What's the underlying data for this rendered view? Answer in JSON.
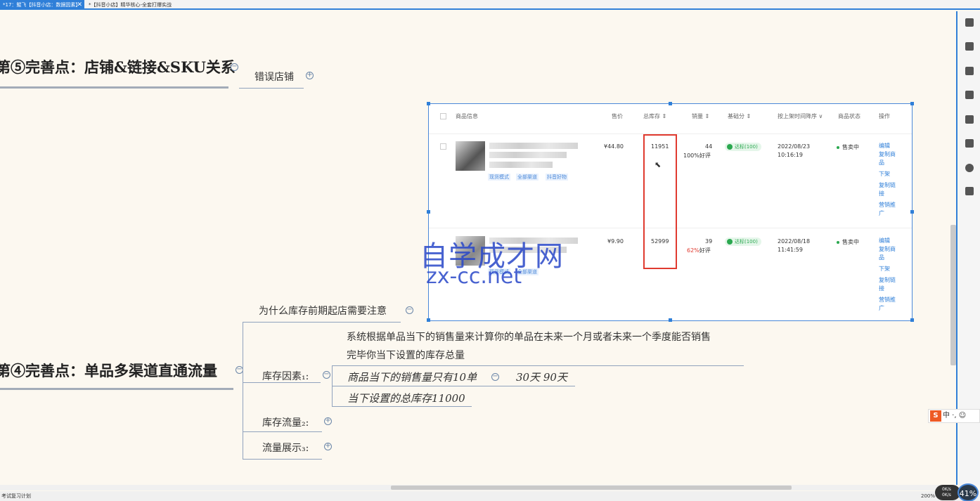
{
  "tabs": [
    {
      "label": "*17：鲲飞【抖音小店：数据因素】",
      "active": true
    },
    {
      "label": "*【抖音小店】精华核心-全套打爆实战",
      "active": false
    }
  ],
  "mindmap": {
    "topic5": {
      "title": "第⑤完善点：店铺&链接&SKU关系",
      "child": "错误店铺"
    },
    "topic4": {
      "title": "第④完善点：单品多渠道直通流量"
    },
    "branch_question": "为什么库存前期起店需要注意",
    "stock_factor": {
      "label": "库存因素₁:",
      "description_line1": "系统根据单品当下的销售量来计算你的单品在未来一个月或者未来一个季度能否销售",
      "description_line2": "完毕你当下设置的库存总量",
      "sub1": "商品当下的销售量只有10单",
      "sub1_child": "30天 90天",
      "sub2": "当下设置的总库存11000"
    },
    "stock_flow": "库存流量₂:",
    "flow_display": "流量展示₃:"
  },
  "product_table": {
    "headers": [
      "商品信息",
      "售价",
      "总库存 ⇕",
      "销量 ⇕",
      "基础分 ⇕",
      "按上架时间降序 ∨",
      "商品状态",
      "操作"
    ],
    "rows": [
      {
        "tags": [
          "现货模式",
          "全部渠道",
          "抖音好物"
        ],
        "price": "¥44.80",
        "stock": "11951",
        "sales": "44",
        "rating_pct": "100%",
        "rating_suffix": "好评",
        "score": "达标(100)",
        "date": "2022/08/23",
        "time": "10:16:19",
        "status": "售卖中",
        "ops": [
          "编辑",
          "复制商品",
          "下架",
          "复制链接",
          "营销推广"
        ]
      },
      {
        "tags": [
          "现货模式",
          "全部渠道"
        ],
        "price": "¥9.90",
        "stock": "52999",
        "sales": "39",
        "rating_pct": "62%",
        "rating_suffix": "好评",
        "score": "达标(100)",
        "date": "2022/08/18",
        "time": "11:41:59",
        "status": "售卖中",
        "ops": [
          "编辑",
          "复制商品",
          "下架",
          "复制链接",
          "营销推广"
        ]
      }
    ]
  },
  "watermark": {
    "cn": "自学成才网",
    "en": "zx-cc.net"
  },
  "statusbar": {
    "left": "考试复习计划",
    "zoom": "200%"
  },
  "network": {
    "up": "0K/s",
    "down": "0K/s"
  },
  "progress_badge": "41%",
  "ime": {
    "logo": "S",
    "text": "中 ·, ☺"
  },
  "colors": {
    "accent": "#2f7fd8",
    "highlight_box": "#e03a2f",
    "status_green": "#2aa84f"
  },
  "sidebar_icons": [
    "outline-icon",
    "brush-icon",
    "image-icon",
    "flag-icon",
    "ai-icon",
    "document-icon",
    "comment-icon",
    "task-icon"
  ]
}
